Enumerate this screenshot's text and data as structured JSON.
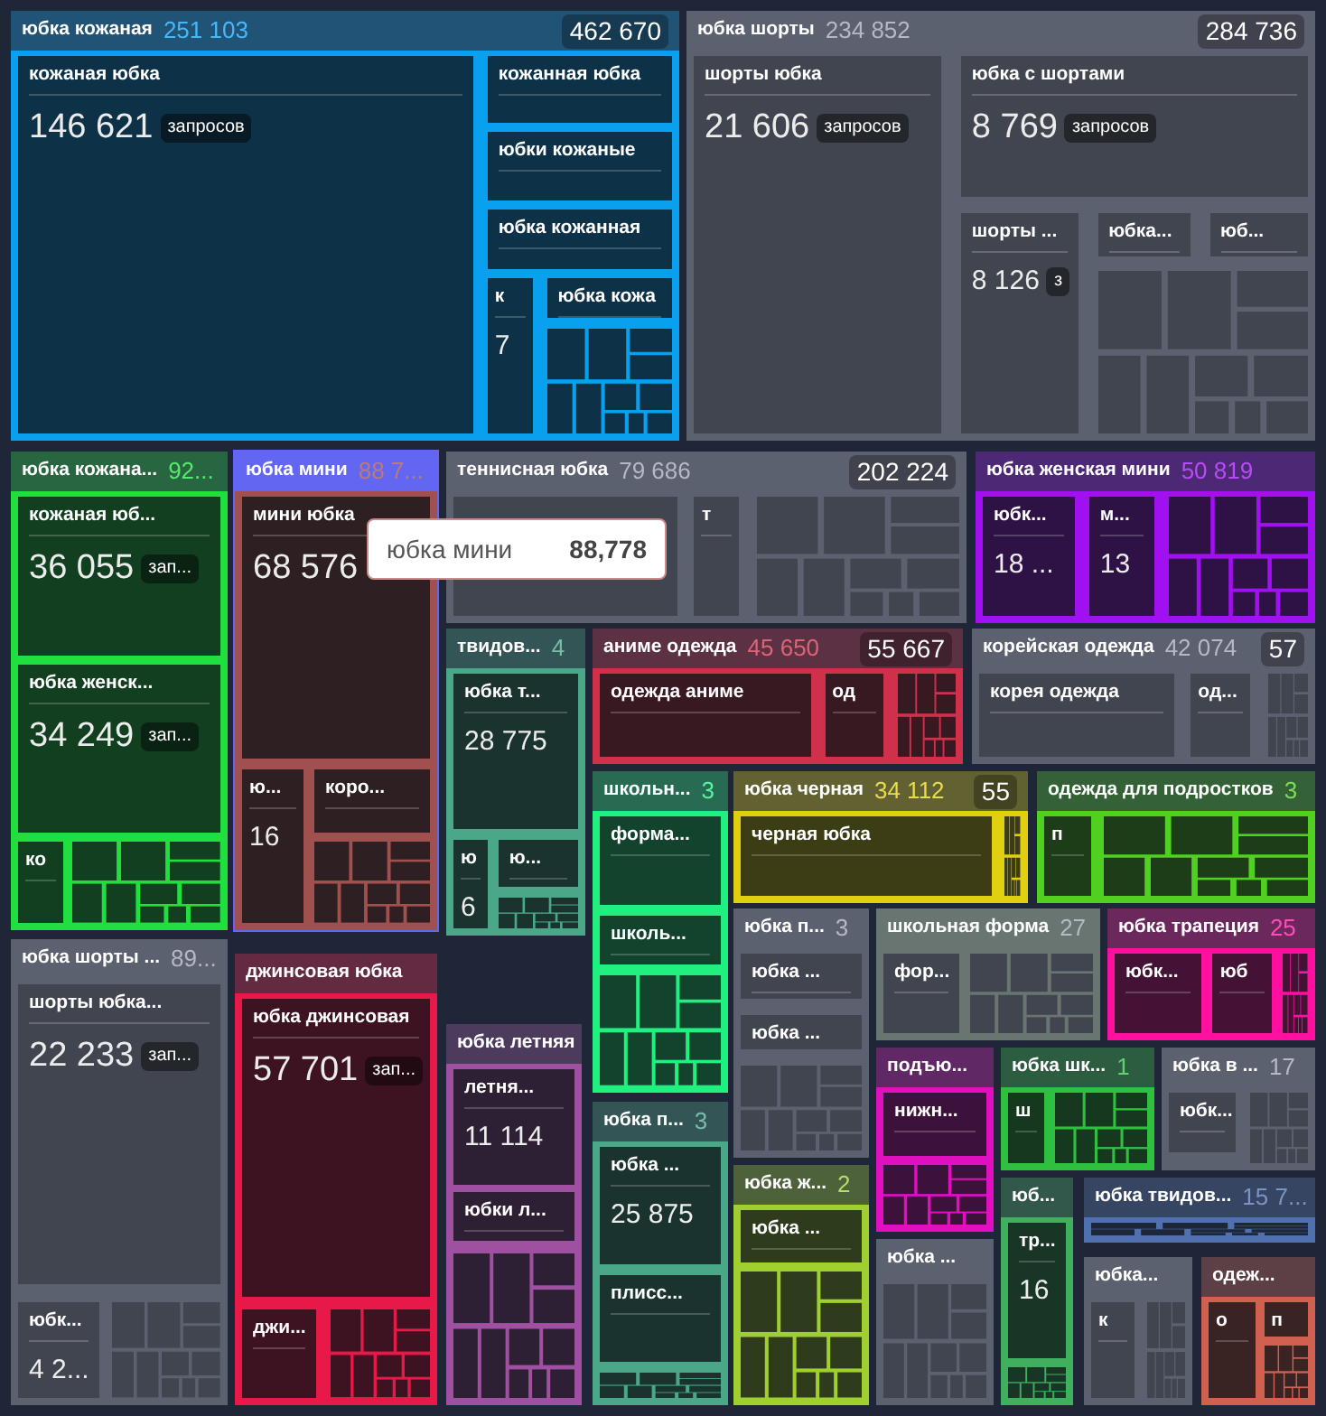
{
  "groups": [
    {
      "title": "юбка кожаная",
      "value": "251 103",
      "total": "462 670",
      "kind": "colored",
      "color": "#0aa0f0",
      "highlighted": false,
      "children": [
        {
          "label": "кожаная юбка",
          "count": "146 621",
          "unit": "запросов"
        },
        {
          "label": "кожанная юбка"
        },
        {
          "label": "юбки кожаные"
        },
        {
          "label": "юбка кожанная"
        },
        {
          "label": "к",
          "count": "7"
        },
        {
          "label": "юбка кожа"
        }
      ]
    },
    {
      "title": "юбка шорты",
      "value": "234 852",
      "total": "284 736",
      "kind": "muted",
      "color": "#5c6170",
      "highlighted": false,
      "children": [
        {
          "label": "шорты юбка",
          "count": "21 606",
          "unit": "запросов"
        },
        {
          "label": "юбка с шортами",
          "count": "8 769",
          "unit": "запросов"
        },
        {
          "label": "шорты ...",
          "count": "8 126",
          "unit": "з"
        },
        {
          "label": "юбка..."
        },
        {
          "label": "юб..."
        }
      ]
    },
    {
      "title": "юбка кожана...",
      "value": "92...",
      "kind": "colored",
      "color": "#20e040",
      "highlighted": false,
      "children": [
        {
          "label": "кожаная юб...",
          "count": "36 055",
          "unit": "зап..."
        },
        {
          "label": "юбка женск...",
          "count": "34 249",
          "unit": "зап..."
        },
        {
          "label": "ко"
        }
      ]
    },
    {
      "title": "юбка мини",
      "value": "88 7...",
      "kind": "colored",
      "color": "#a0504e",
      "highlighted": true,
      "children": [
        {
          "label": "мини юбка",
          "count": "68 576"
        },
        {
          "label": "ю...",
          "count": "16"
        },
        {
          "label": "коро..."
        }
      ]
    },
    {
      "title": "теннисная юбка",
      "value": "79 686",
      "total": "202 224",
      "kind": "muted",
      "color": "#5c6170",
      "highlighted": false,
      "children": [
        {
          "label": "т"
        }
      ]
    },
    {
      "title": "юбка женская мини",
      "value": "50 819",
      "kind": "colored",
      "color": "#a010f0",
      "highlighted": false,
      "children": [
        {
          "label": "юбк...",
          "count": "18 ..."
        },
        {
          "label": "м...",
          "count": "13"
        }
      ]
    },
    {
      "title": "твидов...",
      "value": "4",
      "kind": "colored",
      "color": "#4aa888",
      "highlighted": false,
      "children": [
        {
          "label": "юбка т...",
          "count": "28 775"
        },
        {
          "label": "ю",
          "count": "6"
        },
        {
          "label": "ю..."
        }
      ]
    },
    {
      "title": "аниме одежда",
      "value": "45 650",
      "total": "55 667",
      "kind": "colored",
      "color": "#d0304a",
      "highlighted": false,
      "children": [
        {
          "label": "одежда аниме"
        },
        {
          "label": "од"
        }
      ]
    },
    {
      "title": "корейская одежда",
      "value": "42 074",
      "total": "57",
      "kind": "muted",
      "color": "#5c6170",
      "highlighted": false,
      "children": [
        {
          "label": "корея одежда"
        },
        {
          "label": "од..."
        }
      ]
    },
    {
      "title": "школьн...",
      "value": "3",
      "kind": "colored",
      "color": "#20f080",
      "highlighted": false,
      "children": [
        {
          "label": "форма..."
        },
        {
          "label": "школь..."
        }
      ]
    },
    {
      "title": "юбка черная",
      "value": "34 112",
      "total": "55",
      "kind": "colored",
      "color": "#e0d010",
      "highlighted": false,
      "children": [
        {
          "label": "черная юбка"
        }
      ]
    },
    {
      "title": "одежда для подростков",
      "value": "3",
      "kind": "colored",
      "color": "#50d020",
      "highlighted": false,
      "children": [
        {
          "label": "п"
        }
      ]
    },
    {
      "title": "юбка шорты ...",
      "value": "89...",
      "kind": "muted",
      "color": "#5c6170",
      "highlighted": false,
      "children": [
        {
          "label": "шорты юбка...",
          "count": "22 233",
          "unit": "зап..."
        },
        {
          "label": "юбк...",
          "count": "4 2..."
        }
      ]
    },
    {
      "title": "джинсовая юбка",
      "kind": "colored",
      "color": "#e81848",
      "highlighted": false,
      "children": [
        {
          "label": "юбка джинсовая",
          "count": "57 701",
          "unit": "зап..."
        },
        {
          "label": "джи..."
        }
      ]
    },
    {
      "title": "юбка летняя",
      "kind": "colored",
      "color": "#a050a0",
      "highlighted": false,
      "children": [
        {
          "label": "летня...",
          "count": "11 114"
        },
        {
          "label": "юбки л..."
        }
      ]
    },
    {
      "title": "юбка п...",
      "value": "3",
      "kind": "colored",
      "color": "#4aa888",
      "highlighted": false,
      "children": [
        {
          "label": "юбка ...",
          "count": "25 875"
        },
        {
          "label": "плисс..."
        }
      ]
    },
    {
      "title": "юбка п...",
      "value": "3",
      "kind": "muted",
      "color": "#5c6170",
      "highlighted": false,
      "children": [
        {
          "label": "юбка ..."
        },
        {
          "label": "юбка ..."
        }
      ]
    },
    {
      "title": "школьная форма",
      "value": "27",
      "kind": "muted",
      "color": "#687570",
      "highlighted": false,
      "children": [
        {
          "label": "фор..."
        }
      ]
    },
    {
      "title": "юбка трапеция",
      "value": "25",
      "kind": "colored",
      "color": "#ff10a0",
      "highlighted": false,
      "children": [
        {
          "label": "юбк..."
        },
        {
          "label": "юб"
        }
      ]
    },
    {
      "title": "подъю...",
      "kind": "colored",
      "color": "#e010c0",
      "highlighted": false,
      "children": [
        {
          "label": "нижн..."
        }
      ]
    },
    {
      "title": "юбка шк...",
      "value": "1",
      "kind": "colored",
      "color": "#30c040",
      "highlighted": false,
      "children": [
        {
          "label": "ш"
        }
      ]
    },
    {
      "title": "юбка в ...",
      "value": "17",
      "kind": "muted",
      "color": "#5c6170",
      "highlighted": false,
      "children": [
        {
          "label": "юбк..."
        }
      ]
    },
    {
      "title": "юбка ж...",
      "value": "2",
      "kind": "colored",
      "color": "#a0d030",
      "highlighted": false,
      "children": [
        {
          "label": "юбка ..."
        }
      ]
    },
    {
      "title": "юбка ...",
      "kind": "muted",
      "color": "#5c6170",
      "highlighted": false
    },
    {
      "title": "юб...",
      "kind": "colored",
      "color": "#40b060",
      "highlighted": false,
      "children": [
        {
          "label": "тр...",
          "count": "16"
        }
      ]
    },
    {
      "title": "юбка твидов...",
      "value": "15 7...",
      "kind": "colored",
      "color": "#5070b0",
      "highlighted": false
    },
    {
      "title": "юбка...",
      "kind": "muted",
      "color": "#5c6170",
      "highlighted": false,
      "children": [
        {
          "label": "к"
        }
      ]
    },
    {
      "title": "одеж...",
      "kind": "colored",
      "color": "#d06050",
      "highlighted": false,
      "children": [
        {
          "label": "о"
        },
        {
          "label": "п"
        }
      ]
    }
  ],
  "tooltip": {
    "label": "юбка мини",
    "value": "88,778"
  }
}
